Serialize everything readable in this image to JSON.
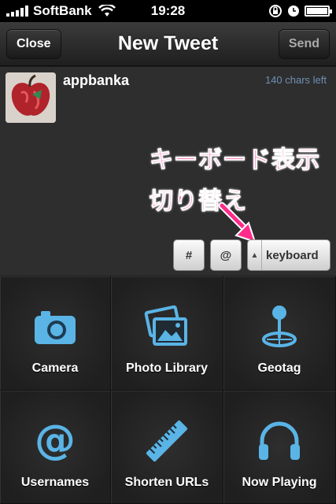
{
  "status_bar": {
    "carrier": "SoftBank",
    "time": "19:28"
  },
  "nav": {
    "close_label": "Close",
    "title": "New Tweet",
    "send_label": "Send"
  },
  "compose": {
    "username": "appbanka",
    "chars_left": "140 chars left",
    "annotation_line1": "キーボード表示",
    "annotation_line2": "切り替え",
    "hashtag_button": "#",
    "mention_button": "@",
    "keyboard_button": "keyboard"
  },
  "toolbar": {
    "items": [
      {
        "label": "Camera",
        "icon": "camera-icon"
      },
      {
        "label": "Photo Library",
        "icon": "photo-library-icon"
      },
      {
        "label": "Geotag",
        "icon": "geotag-icon"
      },
      {
        "label": "Usernames",
        "icon": "at-icon"
      },
      {
        "label": "Shorten URLs",
        "icon": "ruler-icon"
      },
      {
        "label": "Now Playing",
        "icon": "headphones-icon"
      }
    ]
  },
  "colors": {
    "annotation": "#ff2b8a",
    "icon_blue": "#5ab4e6",
    "chars_left": "#6f8fb3"
  }
}
